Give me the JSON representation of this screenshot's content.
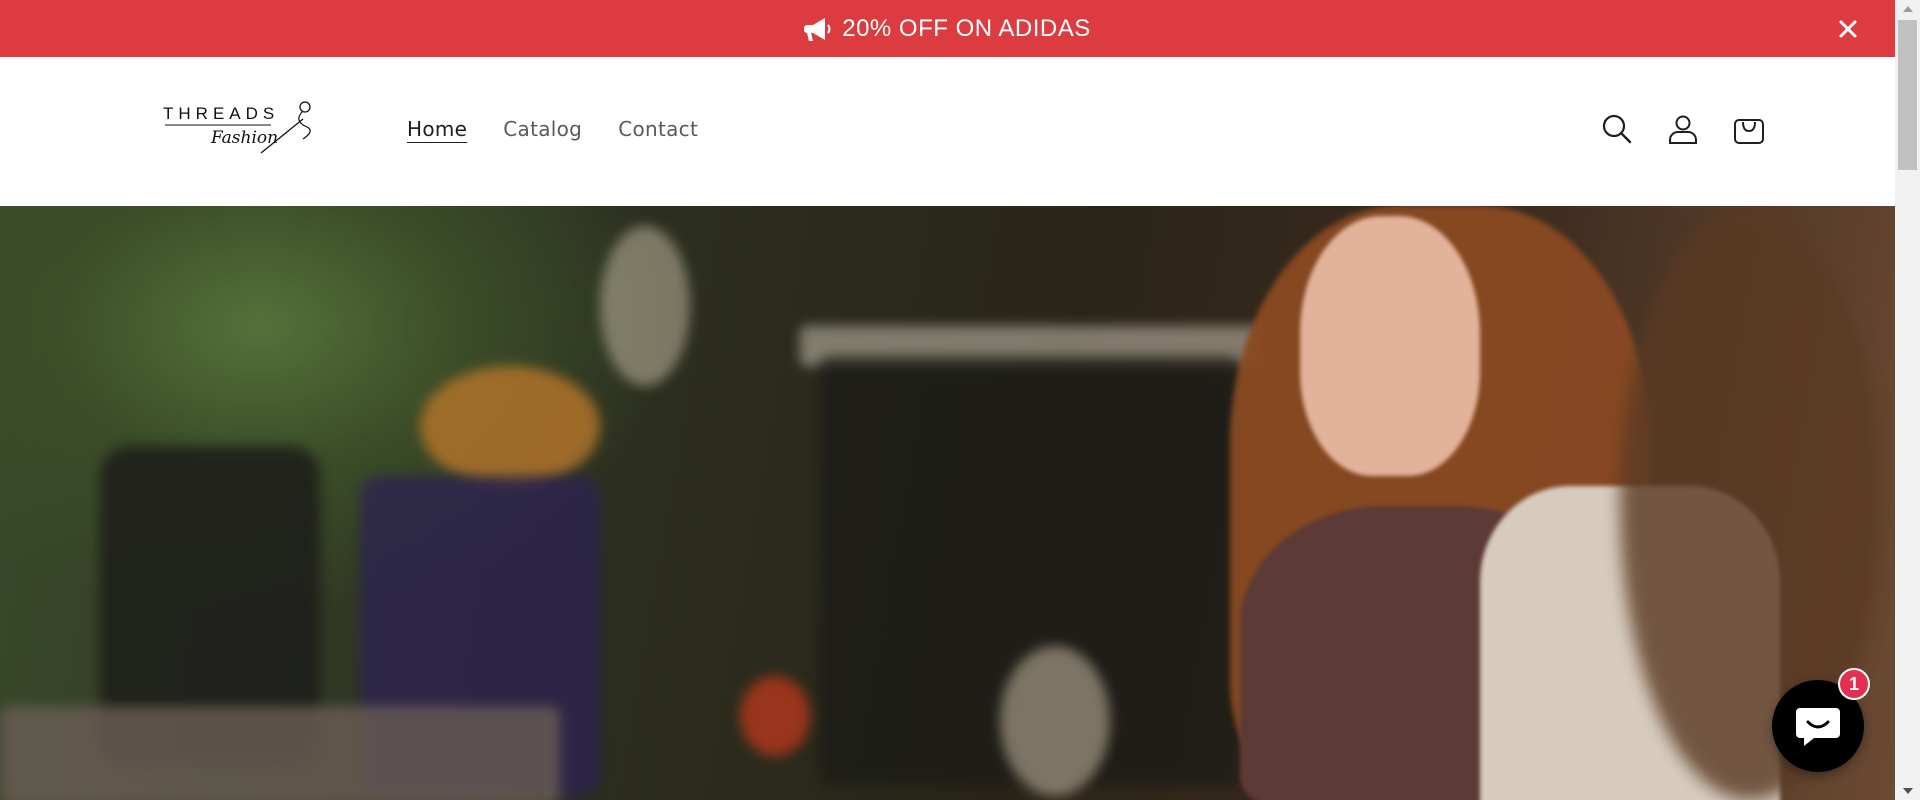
{
  "announcement": {
    "text": "20% OFF ON ADIDAS",
    "icon": "megaphone-icon",
    "background": "#dc3c3f"
  },
  "header": {
    "logo": {
      "line1": "THREADS",
      "line2": "Fashion"
    },
    "nav": [
      {
        "label": "Home",
        "active": true
      },
      {
        "label": "Catalog",
        "active": false
      },
      {
        "label": "Contact",
        "active": false
      }
    ],
    "icons": [
      "search-icon",
      "account-icon",
      "cart-icon"
    ]
  },
  "hero": {
    "image": "woman-with-scarf-browsing-clothing-store"
  },
  "chat": {
    "badge_count": "1",
    "icon": "chat-bubble-icon"
  }
}
